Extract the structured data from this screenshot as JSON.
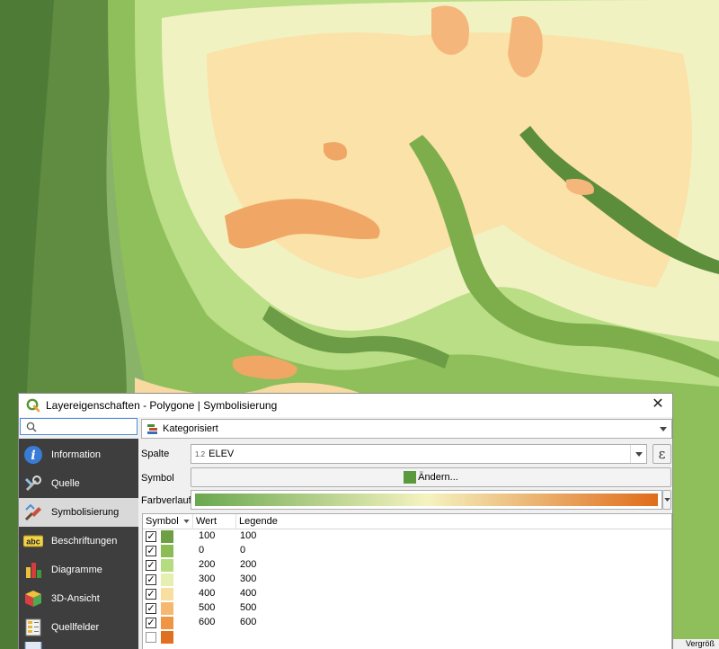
{
  "dialog": {
    "title": "Layereigenschaften - Polygone | Symbolisierung",
    "close_glyph": "✕"
  },
  "search": {
    "value": "",
    "placeholder": ""
  },
  "sidebar": {
    "items": [
      {
        "label": "Information",
        "icon": "info-icon"
      },
      {
        "label": "Quelle",
        "icon": "source-tools-icon"
      },
      {
        "label": "Symbolisierung",
        "icon": "paintbrush-icon",
        "active": true
      },
      {
        "label": "Beschriftungen",
        "icon": "abc-labels-icon"
      },
      {
        "label": "Diagramme",
        "icon": "diagram-icon"
      },
      {
        "label": "3D-Ansicht",
        "icon": "cube-3d-icon"
      },
      {
        "label": "Quellfelder",
        "icon": "fields-icon"
      }
    ]
  },
  "renderer": {
    "type_label": "Kategorisiert"
  },
  "column": {
    "label": "Spalte",
    "type_tag": "1.2",
    "value": "ELEV",
    "expression_glyph": "ε"
  },
  "symbol": {
    "label": "Symbol",
    "button_label": "Ändern...",
    "color": "#5a9a3c"
  },
  "ramp": {
    "label": "Farbverlauf",
    "colors": [
      "#6aa84f",
      "#f5f3c0",
      "#e06c1a"
    ]
  },
  "table": {
    "headers": {
      "symbol": "Symbol",
      "value": "Wert",
      "legend": "Legende"
    },
    "rows": [
      {
        "checked": true,
        "color": "#6f9f45",
        "value": "100",
        "legend": "100"
      },
      {
        "checked": true,
        "color": "#8cbd55",
        "value": "0",
        "legend": "0"
      },
      {
        "checked": true,
        "color": "#b5dc80",
        "value": "200",
        "legend": "200"
      },
      {
        "checked": true,
        "color": "#e5f0b0",
        "value": "300",
        "legend": "300"
      },
      {
        "checked": true,
        "color": "#f8dfa0",
        "value": "400",
        "legend": "400"
      },
      {
        "checked": true,
        "color": "#f5b870",
        "value": "500",
        "legend": "500"
      },
      {
        "checked": true,
        "color": "#ee9645",
        "value": "600",
        "legend": "600"
      },
      {
        "checked": false,
        "color": "#e07020",
        "value": "",
        "legend": ""
      }
    ]
  },
  "status": {
    "text": "Vergröß"
  },
  "map_colors": {
    "low": "#5b8a3c",
    "mid1": "#7aab4f",
    "mid2": "#a5d17a",
    "mid3": "#d9edb0",
    "high1": "#fbe6b4",
    "high2": "#f8c98a",
    "high3": "#f2a15a"
  }
}
